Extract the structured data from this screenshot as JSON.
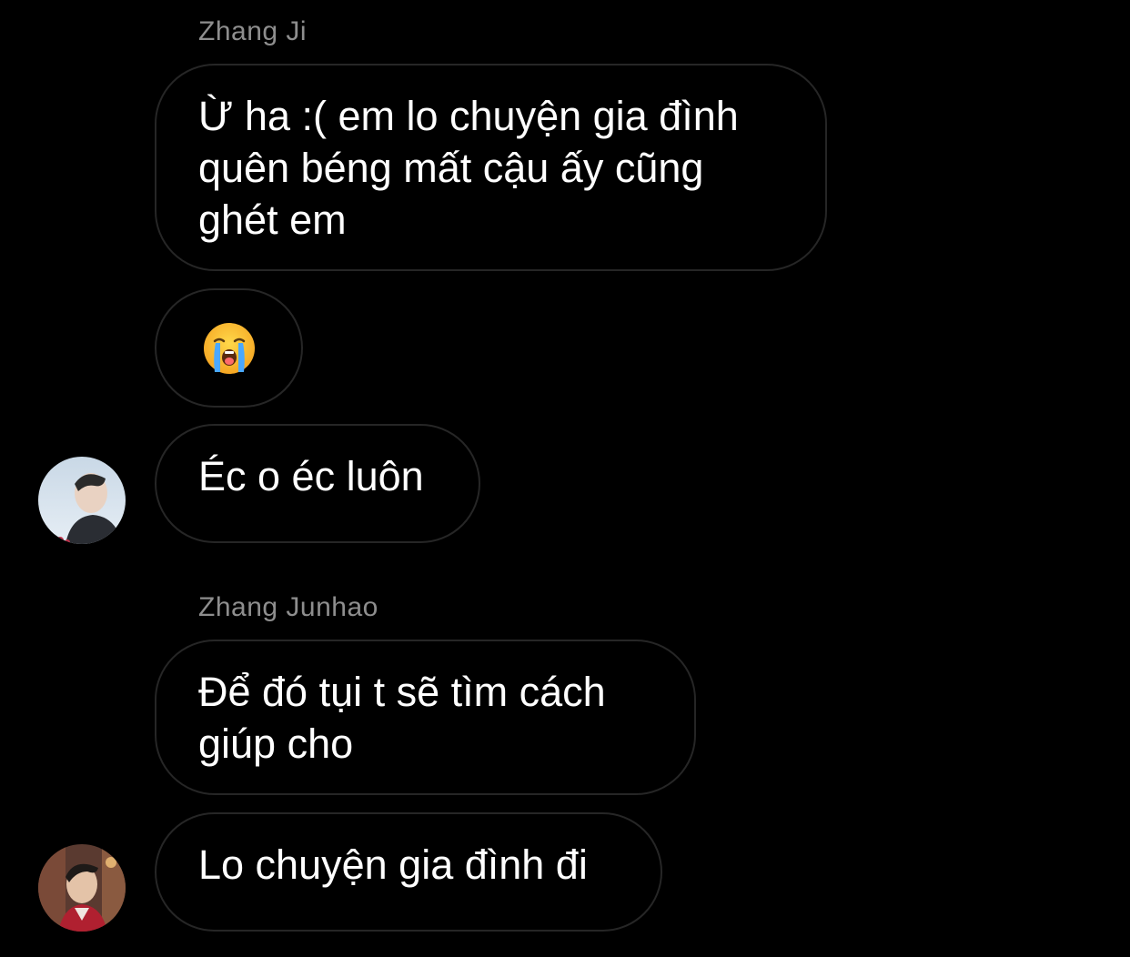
{
  "messages": [
    {
      "sender": "Zhang Ji",
      "bubbles": [
        {
          "text": "Ừ ha :( em lo chuyện gia đình quên béng mất cậu ấy cũng ghét em"
        },
        {
          "emoji": "loudly-crying-face",
          "text": "😭"
        },
        {
          "text": "Éc o éc luôn"
        }
      ]
    },
    {
      "sender": "Zhang Junhao",
      "bubbles": [
        {
          "text": "Để đó tụi t sẽ tìm cách giúp cho"
        },
        {
          "text": "Lo chuyện gia đình đi"
        }
      ]
    }
  ],
  "colors": {
    "background": "#000000",
    "bubble_border": "#262626",
    "sender_name": "#8e8e8e",
    "message_text": "#ffffff"
  }
}
